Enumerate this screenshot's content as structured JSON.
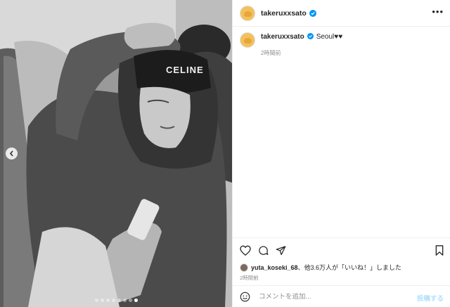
{
  "post": {
    "image_alt": "",
    "carousel": {
      "total": 8,
      "active_index": 7
    }
  },
  "header": {
    "username": "takeruxxsato",
    "verified": true,
    "more_label": "•••"
  },
  "caption": {
    "username": "takeruxxsato",
    "text": "Seoul♥︎♥︎",
    "time": "2時間前"
  },
  "actions": {
    "icons": [
      "heart-icon",
      "comment-icon",
      "share-icon",
      "bookmark-icon"
    ]
  },
  "likes": {
    "liked_by": "yuta_koseki_68",
    "text": "、他3.6万人が「いいね！」しました"
  },
  "post_time": "2時間前",
  "comment": {
    "placeholder": "コメントを追加...",
    "post_label": "投稿する"
  },
  "colors": {
    "accent_blue": "#0095f6",
    "post_button_disabled": "#b2dffc",
    "avatar": "#f3c15b",
    "border": "#efefef"
  }
}
